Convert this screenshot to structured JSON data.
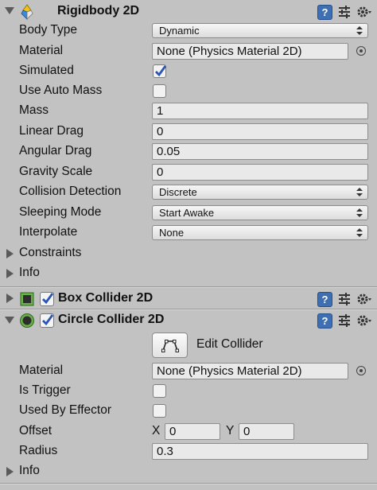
{
  "rigidbody": {
    "title": "Rigidbody 2D",
    "body_type": {
      "label": "Body Type",
      "value": "Dynamic"
    },
    "material": {
      "label": "Material",
      "value": "None (Physics Material 2D)"
    },
    "simulated": {
      "label": "Simulated",
      "checked": true
    },
    "use_auto_mass": {
      "label": "Use Auto Mass",
      "checked": false
    },
    "mass": {
      "label": "Mass",
      "value": "1"
    },
    "linear_drag": {
      "label": "Linear Drag",
      "value": "0"
    },
    "angular_drag": {
      "label": "Angular Drag",
      "value": "0.05"
    },
    "gravity_scale": {
      "label": "Gravity Scale",
      "value": "0"
    },
    "collision_detection": {
      "label": "Collision Detection",
      "value": "Discrete"
    },
    "sleeping_mode": {
      "label": "Sleeping Mode",
      "value": "Start Awake"
    },
    "interpolate": {
      "label": "Interpolate",
      "value": "None"
    },
    "constraints": {
      "label": "Constraints"
    },
    "info": {
      "label": "Info"
    }
  },
  "box_collider": {
    "title": "Box Collider 2D",
    "enabled": true
  },
  "circle_collider": {
    "title": "Circle Collider 2D",
    "enabled": true,
    "edit_collider": {
      "label": "Edit Collider"
    },
    "material": {
      "label": "Material",
      "value": "None (Physics Material 2D)"
    },
    "is_trigger": {
      "label": "Is Trigger",
      "checked": false
    },
    "used_by_effector": {
      "label": "Used By Effector",
      "checked": false
    },
    "offset": {
      "label": "Offset",
      "x_label": "X",
      "x": "0",
      "y_label": "Y",
      "y": "0"
    },
    "radius": {
      "label": "Radius",
      "value": "0.3"
    },
    "info": {
      "label": "Info"
    }
  },
  "colors": {
    "help_icon": "#3f6fb3",
    "panel_bg": "#c2c2c2",
    "field_bg": "#e9e9e9"
  }
}
